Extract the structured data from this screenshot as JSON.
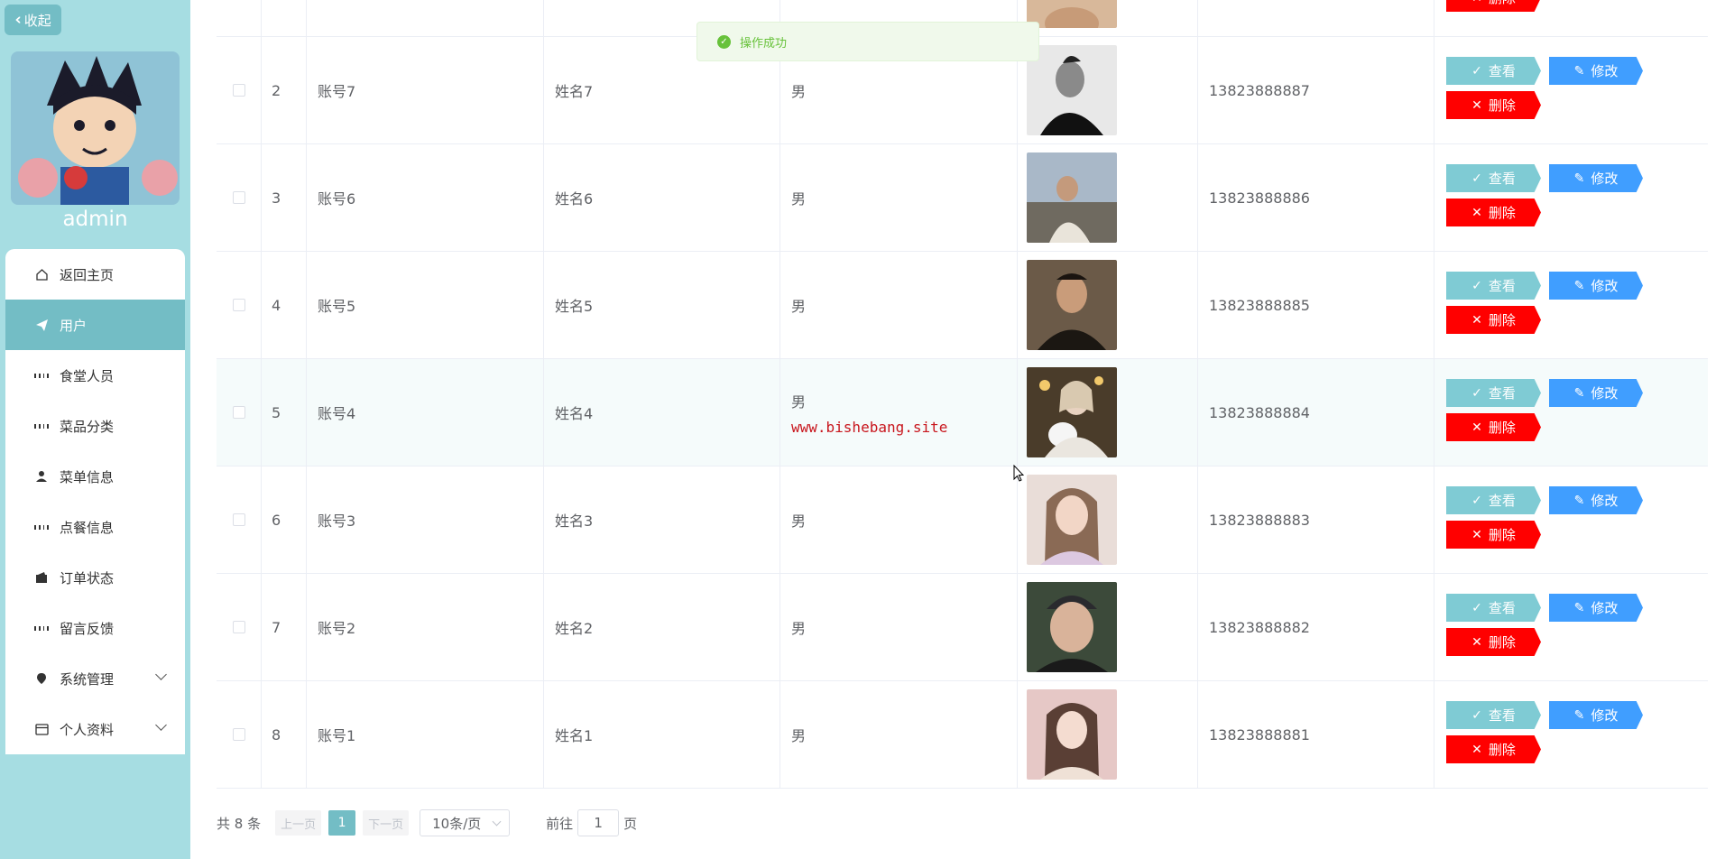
{
  "sidebar": {
    "collapse_label": "收起",
    "username": "admin",
    "menu": [
      {
        "label": "返回主页",
        "icon": "home-icon"
      },
      {
        "label": "用户",
        "icon": "send-icon",
        "active": true
      },
      {
        "label": "食堂人员",
        "icon": "grid-icon"
      },
      {
        "label": "菜品分类",
        "icon": "grid-icon"
      },
      {
        "label": "菜单信息",
        "icon": "person-icon"
      },
      {
        "label": "点餐信息",
        "icon": "grid-icon"
      },
      {
        "label": "订单状态",
        "icon": "wallet-icon"
      },
      {
        "label": "留言反馈",
        "icon": "grid-icon"
      },
      {
        "label": "系统管理",
        "icon": "pin-icon",
        "expandable": true
      },
      {
        "label": "个人资料",
        "icon": "card-icon",
        "expandable": true
      }
    ]
  },
  "toast": {
    "message": "操作成功"
  },
  "table": {
    "rows": [
      {
        "index": "2",
        "account": "账号7",
        "name": "姓名7",
        "sex": "男",
        "phone": "13823888887"
      },
      {
        "index": "3",
        "account": "账号6",
        "name": "姓名6",
        "sex": "男",
        "phone": "13823888886"
      },
      {
        "index": "4",
        "account": "账号5",
        "name": "姓名5",
        "sex": "男",
        "phone": "13823888885"
      },
      {
        "index": "5",
        "account": "账号4",
        "name": "姓名4",
        "sex": "男",
        "phone": "13823888884"
      },
      {
        "index": "6",
        "account": "账号3",
        "name": "姓名3",
        "sex": "男",
        "phone": "13823888883"
      },
      {
        "index": "7",
        "account": "账号2",
        "name": "姓名2",
        "sex": "男",
        "phone": "13823888882"
      },
      {
        "index": "8",
        "account": "账号1",
        "name": "姓名1",
        "sex": "男",
        "phone": "13823888881"
      }
    ],
    "view_label": "查看",
    "edit_label": "修改",
    "delete_label": "删除",
    "watermark": "www.bishebang.site"
  },
  "pagination": {
    "total": "共 8 条",
    "prev": "上一页",
    "current": "1",
    "next": "下一页",
    "page_size": "10条/页",
    "goto_prefix": "前往",
    "goto_value": "1",
    "goto_suffix": "页"
  },
  "colors": {
    "sidebar_bg": "#a6dde2",
    "accent": "#73bdc5",
    "view_btn": "#7fcbd4",
    "edit_btn": "#409eff",
    "delete_btn": "#ff0000",
    "success": "#67c23a"
  }
}
